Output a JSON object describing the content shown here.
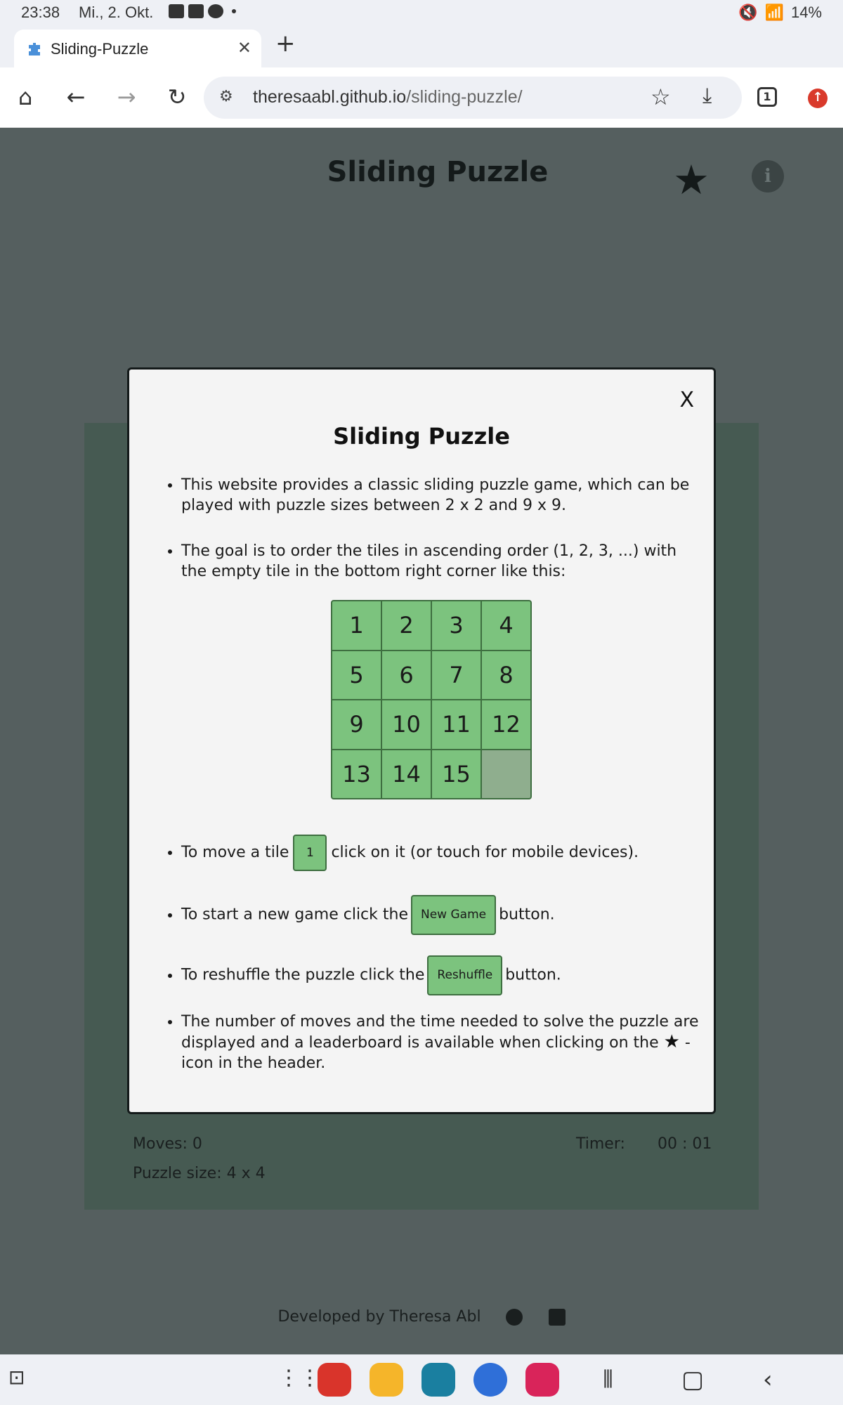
{
  "status": {
    "time": "23:38",
    "date": "Mi., 2. Okt.",
    "battery": "14%"
  },
  "tab": {
    "title": "Sliding-Puzzle",
    "close": "✕",
    "new_tab": "+"
  },
  "toolbar": {
    "url_host": "theresaabl.github.io",
    "url_path": "/sliding-puzzle/",
    "tab_count": "1"
  },
  "header": {
    "title": "Sliding Puzzle"
  },
  "game": {
    "moves": "Moves: 0",
    "puzzle_size": "Puzzle size: 4 x 4",
    "timer_label": "Timer:",
    "timer_value": "00 : 01"
  },
  "footer": {
    "credit": "Developed by Theresa Abl"
  },
  "modal": {
    "close": "X",
    "title": "Sliding Puzzle",
    "p1": "This website provides a classic sliding puzzle game, which can be played with puzzle sizes between 2 x 2 and 9 x 9.",
    "p2": "The goal is to order the tiles in ascending order (1, 2, 3, ...) with the empty tile in the bottom right corner like this:",
    "tiles": [
      "1",
      "2",
      "3",
      "4",
      "5",
      "6",
      "7",
      "8",
      "9",
      "10",
      "11",
      "12",
      "13",
      "14",
      "15",
      ""
    ],
    "p3_before": "To move a tile",
    "p3_tile": "1",
    "p3_after": "click on it (or touch for mobile devices).",
    "p4_before": "To start a new game click the",
    "p4_button": "New Game",
    "p4_after": "button.",
    "p5_before": "To reshuffle the puzzle click the",
    "p5_button": "Reshuffle",
    "p5_after": "button.",
    "p6_before": "The number of moves and the time needed to solve the puzzle are displayed and a leaderboard is available when clicking on the",
    "p6_after": "- icon in the header."
  },
  "colors": {
    "tile": "#7cc37e",
    "tile_border": "#3e6e40",
    "overlay": "#555f5f",
    "modal_bg": "#f4f4f4"
  }
}
